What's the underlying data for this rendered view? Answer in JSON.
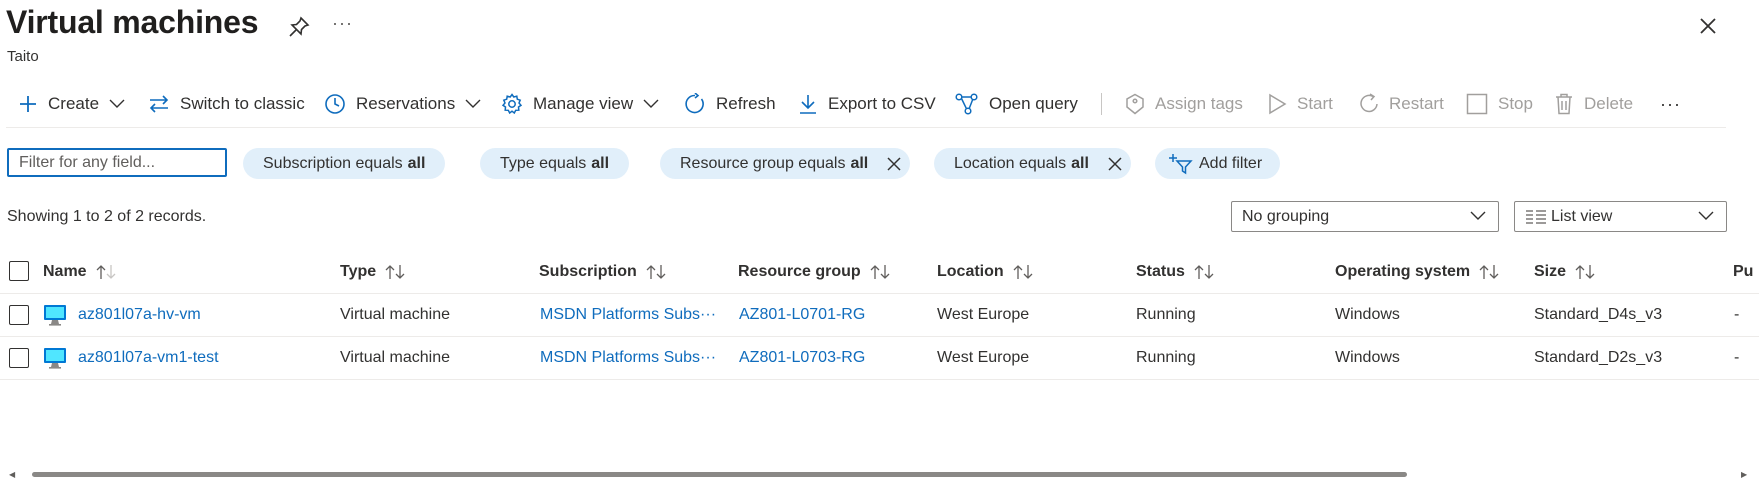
{
  "page": {
    "title": "Virtual machines",
    "subtitle": "Taito",
    "more_glyph": "···"
  },
  "toolbar": {
    "create": "Create",
    "switch_classic": "Switch to classic",
    "reservations": "Reservations",
    "manage_view": "Manage view",
    "refresh": "Refresh",
    "export_csv": "Export to CSV",
    "open_query": "Open query",
    "assign_tags": "Assign tags",
    "start": "Start",
    "restart": "Restart",
    "stop": "Stop",
    "delete": "Delete",
    "more_glyph": "···"
  },
  "filters": {
    "search_placeholder": "Filter for any field...",
    "pills": [
      {
        "label": "Subscription equals",
        "value": "all"
      },
      {
        "label": "Type equals",
        "value": "all"
      },
      {
        "label": "Resource group equals",
        "value": "all"
      },
      {
        "label": "Location equals",
        "value": "all"
      }
    ],
    "add_filter": "Add filter"
  },
  "records_text": "Showing 1 to 2 of 2 records.",
  "grouping": {
    "selected": "No grouping"
  },
  "view_mode": {
    "selected": "List view"
  },
  "table": {
    "headers": [
      "Name",
      "Type",
      "Subscription",
      "Resource group",
      "Location",
      "Status",
      "Operating system",
      "Size",
      "Pu"
    ],
    "rows": [
      {
        "name": "az801l07a-hv-vm",
        "type": "Virtual machine",
        "subscription": "MSDN Platforms Subs···",
        "resource_group": "AZ801-L0701-RG",
        "location": "West Europe",
        "status": "Running",
        "os": "Windows",
        "size": "Standard_D4s_v3",
        "pu": "-"
      },
      {
        "name": "az801l07a-vm1-test",
        "type": "Virtual machine",
        "subscription": "MSDN Platforms Subs···",
        "resource_group": "AZ801-L0703-RG",
        "location": "West Europe",
        "status": "Running",
        "os": "Windows",
        "size": "Standard_D2s_v3",
        "pu": "-"
      }
    ]
  },
  "colors": {
    "accent": "#0f6cbd",
    "pill_bg": "#e1effa",
    "disabled": "#a19f9d"
  },
  "icons": [
    "pin-icon",
    "close-icon",
    "plus-icon",
    "swap-icon",
    "clock-icon",
    "gear-icon",
    "refresh-icon",
    "download-icon",
    "query-icon",
    "tag-icon",
    "play-icon",
    "restart-icon",
    "stop-icon",
    "trash-icon",
    "filter-add-icon",
    "list-view-icon",
    "vm-monitor-icon",
    "sort-icon",
    "chevron-down-icon"
  ]
}
